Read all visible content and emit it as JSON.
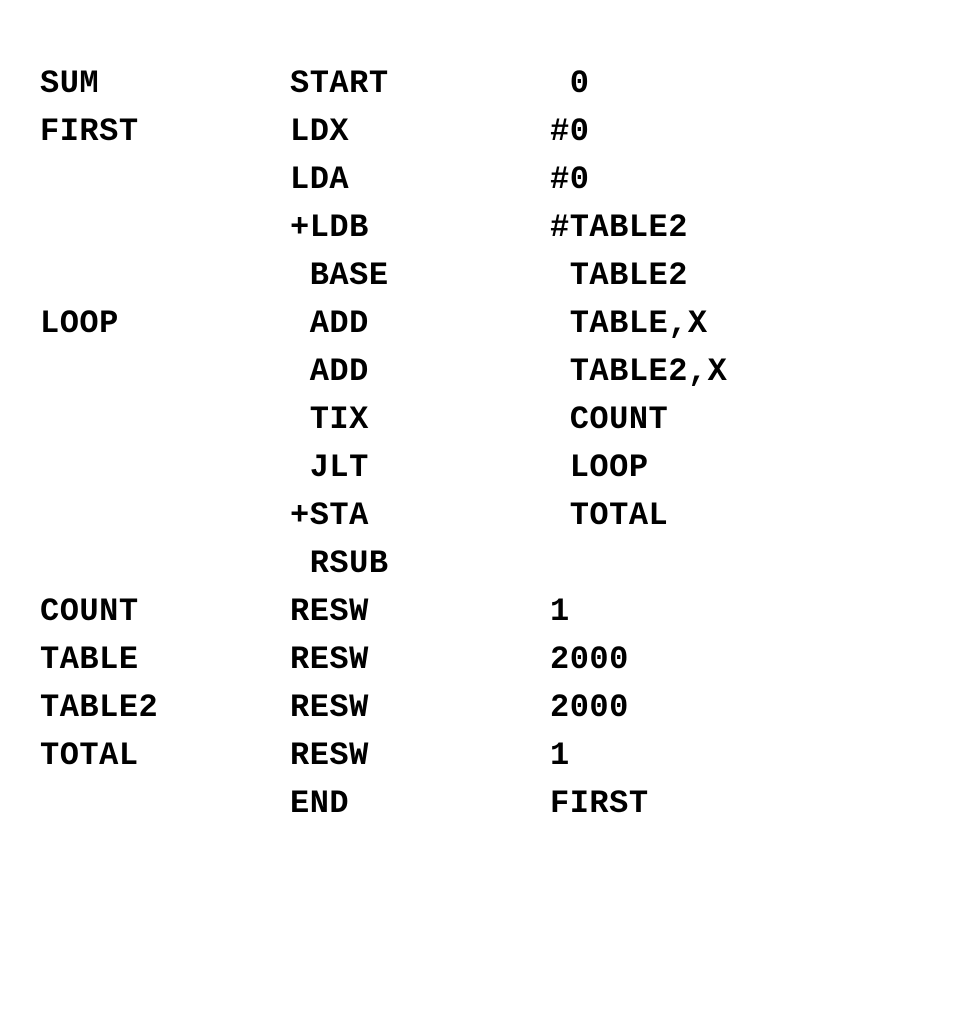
{
  "code": {
    "lines": [
      {
        "label": "SUM",
        "opcode": "START",
        "operand": " 0"
      },
      {
        "label": "FIRST",
        "opcode": "LDX",
        "operand": "#0"
      },
      {
        "label": "",
        "opcode": "LDA",
        "operand": "#0"
      },
      {
        "label": "",
        "opcode": "+LDB",
        "operand": "#TABLE2"
      },
      {
        "label": "",
        "opcode": " BASE",
        "operand": " TABLE2"
      },
      {
        "label": "LOOP",
        "opcode": " ADD",
        "operand": " TABLE,X"
      },
      {
        "label": "",
        "opcode": " ADD",
        "operand": " TABLE2,X"
      },
      {
        "label": "",
        "opcode": " TIX",
        "operand": " COUNT"
      },
      {
        "label": "",
        "opcode": " JLT",
        "operand": " LOOP"
      },
      {
        "label": "",
        "opcode": "+STA",
        "operand": " TOTAL"
      },
      {
        "label": "",
        "opcode": " RSUB",
        "operand": ""
      },
      {
        "label": "COUNT",
        "opcode": "RESW",
        "operand": "1"
      },
      {
        "label": "TABLE",
        "opcode": "RESW",
        "operand": "2000"
      },
      {
        "label": "TABLE2",
        "opcode": "RESW",
        "operand": "2000"
      },
      {
        "label": "TOTAL",
        "opcode": "RESW",
        "operand": "1"
      },
      {
        "label": "",
        "opcode": "END",
        "operand": "FIRST"
      }
    ]
  }
}
